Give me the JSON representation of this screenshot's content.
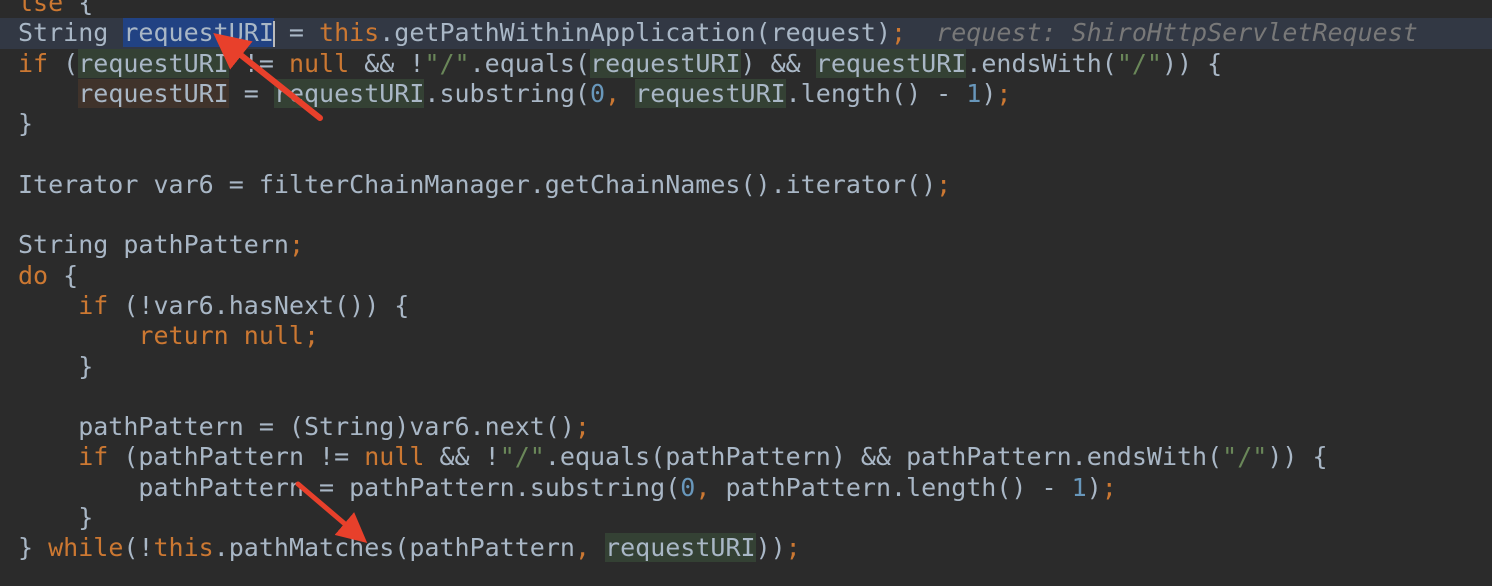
{
  "editor": {
    "lines": [
      {
        "tokens": [
          {
            "t": "lse",
            "c": "kw"
          },
          {
            "t": " {",
            "c": "ident"
          }
        ]
      },
      {
        "current": true,
        "tokens": [
          {
            "t": "String ",
            "c": "ident"
          },
          {
            "t": "requestURI",
            "c": "ident",
            "hl": "sel"
          },
          {
            "t": "",
            "c": "caret"
          },
          {
            "t": " = ",
            "c": "ident"
          },
          {
            "t": "this",
            "c": "kw"
          },
          {
            "t": ".getPathWithinApplication(request)",
            "c": "ident"
          },
          {
            "t": ";",
            "c": "kw"
          },
          {
            "t": "  request: ShiroHttpServletRequest",
            "c": "hint"
          }
        ]
      },
      {
        "tokens": [
          {
            "t": "if",
            "c": "kw"
          },
          {
            "t": " (",
            "c": "ident"
          },
          {
            "t": "requestURI",
            "c": "ident",
            "hl": "read"
          },
          {
            "t": " != ",
            "c": "ident"
          },
          {
            "t": "null",
            "c": "kw"
          },
          {
            "t": " && !",
            "c": "ident"
          },
          {
            "t": "\"/\"",
            "c": "str"
          },
          {
            "t": ".equals(",
            "c": "ident"
          },
          {
            "t": "requestURI",
            "c": "ident",
            "hl": "read"
          },
          {
            "t": ") && ",
            "c": "ident"
          },
          {
            "t": "requestURI",
            "c": "ident",
            "hl": "read"
          },
          {
            "t": ".endsWith(",
            "c": "ident"
          },
          {
            "t": "\"/\"",
            "c": "str"
          },
          {
            "t": ")) {",
            "c": "ident"
          }
        ]
      },
      {
        "tokens": [
          {
            "t": "    ",
            "c": "ident"
          },
          {
            "t": "requestURI",
            "c": "ident",
            "hl": "write"
          },
          {
            "t": " = ",
            "c": "ident"
          },
          {
            "t": "requestURI",
            "c": "ident",
            "hl": "read"
          },
          {
            "t": ".substring(",
            "c": "ident"
          },
          {
            "t": "0",
            "c": "num"
          },
          {
            "t": ", ",
            "c": "kw"
          },
          {
            "t": "requestURI",
            "c": "ident",
            "hl": "read"
          },
          {
            "t": ".length() - ",
            "c": "ident"
          },
          {
            "t": "1",
            "c": "num"
          },
          {
            "t": ")",
            "c": "ident"
          },
          {
            "t": ";",
            "c": "kw"
          }
        ]
      },
      {
        "tokens": [
          {
            "t": "}",
            "c": "ident"
          }
        ]
      },
      {
        "tokens": []
      },
      {
        "tokens": [
          {
            "t": "Iterator var6 = filterChainManager.getChainNames().iterator()",
            "c": "ident"
          },
          {
            "t": ";",
            "c": "kw"
          }
        ]
      },
      {
        "tokens": []
      },
      {
        "tokens": [
          {
            "t": "String pathPattern",
            "c": "ident"
          },
          {
            "t": ";",
            "c": "kw"
          }
        ]
      },
      {
        "tokens": [
          {
            "t": "do",
            "c": "kw"
          },
          {
            "t": " {",
            "c": "ident"
          }
        ]
      },
      {
        "tokens": [
          {
            "t": "    ",
            "c": "ident"
          },
          {
            "t": "if",
            "c": "kw"
          },
          {
            "t": " (!var6.hasNext()) {",
            "c": "ident"
          }
        ]
      },
      {
        "tokens": [
          {
            "t": "        ",
            "c": "ident"
          },
          {
            "t": "return null;",
            "c": "kw"
          }
        ]
      },
      {
        "tokens": [
          {
            "t": "    }",
            "c": "ident"
          }
        ]
      },
      {
        "tokens": []
      },
      {
        "tokens": [
          {
            "t": "    pathPattern = (String)var6.next()",
            "c": "ident"
          },
          {
            "t": ";",
            "c": "kw"
          }
        ]
      },
      {
        "tokens": [
          {
            "t": "    ",
            "c": "ident"
          },
          {
            "t": "if",
            "c": "kw"
          },
          {
            "t": " (pathPattern != ",
            "c": "ident"
          },
          {
            "t": "null",
            "c": "kw"
          },
          {
            "t": " && !",
            "c": "ident"
          },
          {
            "t": "\"/\"",
            "c": "str"
          },
          {
            "t": ".equals(pathPattern) && pathPattern.endsWith(",
            "c": "ident"
          },
          {
            "t": "\"/\"",
            "c": "str"
          },
          {
            "t": ")) {",
            "c": "ident"
          }
        ]
      },
      {
        "tokens": [
          {
            "t": "        pathPattern = pathPattern.substring(",
            "c": "ident"
          },
          {
            "t": "0",
            "c": "num"
          },
          {
            "t": ", ",
            "c": "kw"
          },
          {
            "t": "pathPattern.length() - ",
            "c": "ident"
          },
          {
            "t": "1",
            "c": "num"
          },
          {
            "t": ")",
            "c": "ident"
          },
          {
            "t": ";",
            "c": "kw"
          }
        ]
      },
      {
        "tokens": [
          {
            "t": "    }",
            "c": "ident"
          }
        ]
      },
      {
        "tokens": [
          {
            "t": "} ",
            "c": "ident"
          },
          {
            "t": "while",
            "c": "kw"
          },
          {
            "t": "(!",
            "c": "ident"
          },
          {
            "t": "this",
            "c": "kw"
          },
          {
            "t": ".pathMatches(pathPattern",
            "c": "ident"
          },
          {
            "t": ", ",
            "c": "kw"
          },
          {
            "t": "requestURI",
            "c": "ident",
            "hl": "read"
          },
          {
            "t": "))",
            "c": "ident"
          },
          {
            "t": ";",
            "c": "kw"
          }
        ]
      }
    ]
  },
  "colors": {
    "background": "#2b2b2b",
    "current_line": "#323844",
    "keyword": "#cc7832",
    "number": "#6897bb",
    "string": "#6a8759",
    "identifier": "#a9b7c6",
    "inlay_hint": "#787878",
    "annotation_arrow": "#e8402b"
  },
  "annotations": [
    {
      "kind": "arrow",
      "points_at": "requestURI declaration",
      "icon": "red-arrow-icon"
    },
    {
      "kind": "arrow",
      "points_at": "pathMatches call",
      "icon": "red-arrow-icon"
    }
  ]
}
